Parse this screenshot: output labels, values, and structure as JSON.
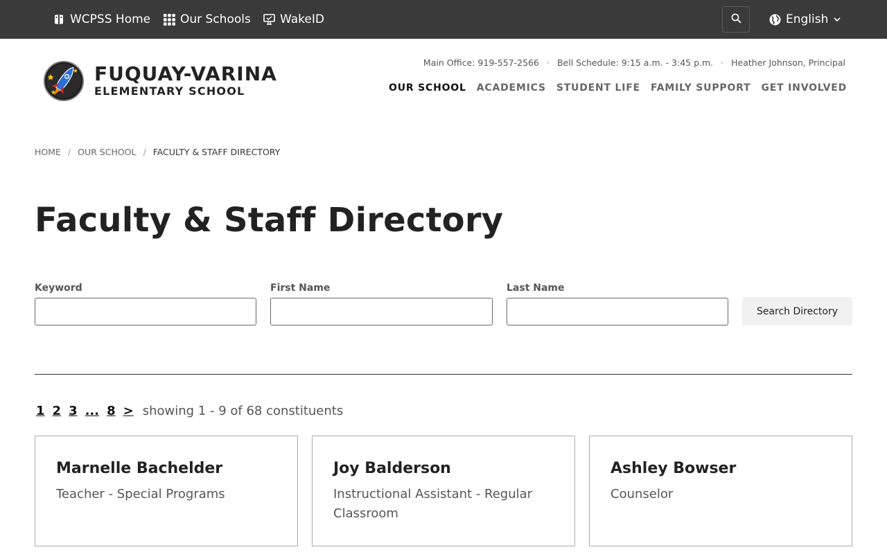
{
  "topbar": {
    "links": [
      {
        "label": "WCPSS Home",
        "icon": "building-icon"
      },
      {
        "label": "Our Schools",
        "icon": "grid-icon"
      },
      {
        "label": "WakeID",
        "icon": "computer-icon"
      }
    ],
    "search_icon": "search-icon",
    "language": "English"
  },
  "header": {
    "school_name_line1": "FUQUAY-VARINA",
    "school_name_line2": "ELEMENTARY SCHOOL",
    "info": {
      "office": "Main Office: 919-557-2566",
      "bell": "Bell Schedule: 9:15 a.m. - 3:45 p.m.",
      "principal": "Heather Johnson, Principal",
      "separator": "·"
    },
    "nav": [
      {
        "label": "OUR SCHOOL",
        "active": true
      },
      {
        "label": "ACADEMICS",
        "active": false
      },
      {
        "label": "STUDENT LIFE",
        "active": false
      },
      {
        "label": "FAMILY SUPPORT",
        "active": false
      },
      {
        "label": "GET INVOLVED",
        "active": false
      }
    ]
  },
  "breadcrumb": {
    "items": [
      "HOME",
      "OUR SCHOOL",
      "FACULTY & STAFF DIRECTORY"
    ],
    "separator": "/"
  },
  "page_title": "Faculty & Staff Directory",
  "search_form": {
    "keyword_label": "Keyword",
    "keyword_value": "",
    "first_name_label": "First Name",
    "first_name_value": "",
    "last_name_label": "Last Name",
    "last_name_value": "",
    "submit_label": "Search Directory"
  },
  "pagination": {
    "pages": [
      "1",
      "2",
      "3",
      "...",
      "8",
      ">"
    ],
    "showing_text": "showing 1 - 9 of 68 constituents"
  },
  "staff": [
    {
      "name": "Marnelle Bachelder",
      "role": "Teacher - Special Programs"
    },
    {
      "name": "Joy Balderson",
      "role": "Instructional Assistant - Regular Classroom"
    },
    {
      "name": "Ashley Bowser",
      "role": "Counselor"
    }
  ],
  "colors": {
    "topbar_bg": "#3a3a3a",
    "text_dark": "#222222",
    "text_muted": "#555555",
    "button_bg": "#f1f1f1"
  }
}
